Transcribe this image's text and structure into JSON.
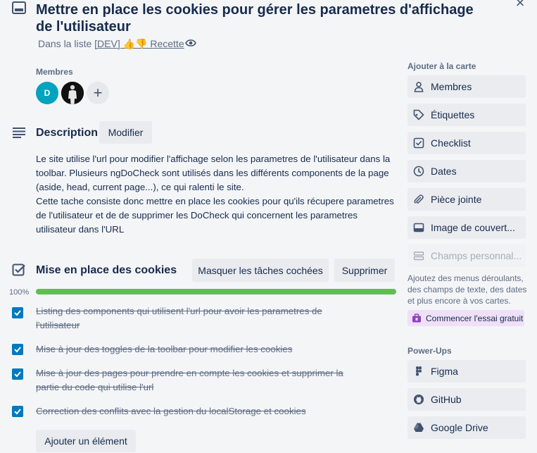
{
  "card": {
    "title": "Mettre en place les cookies pour gérer les parametres d'affichage de l'utilisateur",
    "in_list_prefix": "Dans la liste ",
    "list_name": "[DEV] 👍👎 Recette",
    "icon": "card-icon",
    "close_icon": "close-icon",
    "watch_icon": "eye-icon"
  },
  "members": {
    "label": "Membres",
    "avatars": [
      {
        "initials": "D",
        "color": "#00a3bf"
      },
      {
        "initials": "",
        "color": "#111111"
      }
    ],
    "add_symbol": "+"
  },
  "description": {
    "title": "Description",
    "edit_label": "Modifier",
    "paragraphs": [
      "Le site utilise l'url pour modifier l'affichage selon les parametres de l'utilisateur dans la toolbar. Plusieurs ngDoCheck sont utilisés dans les différents components de la page (aside, head, current page...), ce qui ralenti le site.",
      "Cette tache consiste donc mettre en place les cookies pour qu'ils récupere parametres de l'utilisateur et de de supprimer les DoCheck qui concernent les parametres utilisateur dans l'URL"
    ]
  },
  "checklist": {
    "title": "Mise en place des cookies",
    "hide_checked_label": "Masquer les tâches cochées",
    "delete_label": "Supprimer",
    "progress_text": "100%",
    "progress": 1.0,
    "progress_color": "#61bd4f",
    "items": [
      {
        "text": "Listing des components qui utilisent l'url pour avoir les parametres de l'utilisateur",
        "checked": true
      },
      {
        "text": "Mise à jour des toggles de la toolbar pour modifier les cookies",
        "checked": true
      },
      {
        "text": "Mise à jour des pages pour prendre en compte les cookies et supprimer la partie du code qui utilise l'url",
        "checked": true
      },
      {
        "text": "Correction des conflits avec la gestion du localStorage et cookies",
        "checked": true
      }
    ],
    "add_item_label": "Ajouter un élément"
  },
  "sidebar": {
    "add_to_card_label": "Ajouter à la carte",
    "actions": [
      {
        "label": "Membres",
        "icon": "person-icon"
      },
      {
        "label": "Étiquettes",
        "icon": "label-icon"
      },
      {
        "label": "Checklist",
        "icon": "checklist-icon"
      },
      {
        "label": "Dates",
        "icon": "clock-icon"
      },
      {
        "label": "Pièce jointe",
        "icon": "paperclip-icon"
      },
      {
        "label": "Image de couvert...",
        "icon": "cover-icon"
      },
      {
        "label": "Champs personnal...",
        "icon": "custom-fields-icon",
        "disabled": true
      }
    ],
    "hint": "Ajoutez des menus déroulants, des champs de texte, des dates et plus encore à vos cartes.",
    "trial_label": "Commencer l'essai gratuit",
    "trial_color": "#efe0f7",
    "powerups_label": "Power-Ups",
    "powerups": [
      {
        "label": "Figma",
        "icon": "figma-icon"
      },
      {
        "label": "GitHub",
        "icon": "github-icon"
      },
      {
        "label": "Google Drive",
        "icon": "google-drive-icon"
      }
    ]
  }
}
